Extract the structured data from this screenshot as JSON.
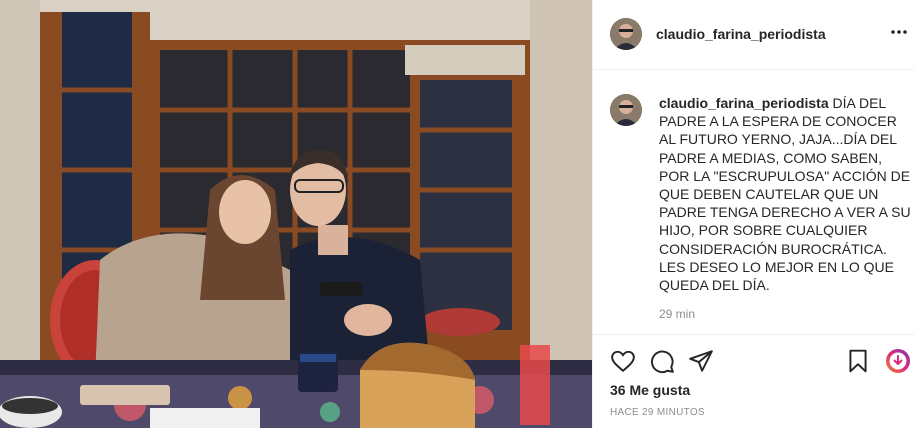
{
  "post": {
    "username": "claudio_farina_periodista",
    "more_icon": "more-horizontal-icon",
    "caption_username": "claudio_farina_periodista",
    "caption_text": "DÍA DEL PADRE A LA ESPERA DE CONOCER AL FUTURO YERNO, JAJA...DÍA DEL PADRE A MEDIAS, COMO SABEN, POR LA \"ESCRUPULOSA\" ACCIÓN DE QUE DEBEN CAUTELAR QUE UN PADRE TENGA DERECHO A VER A SU HIJO, POR SOBRE CUALQUIER CONSIDERACIÓN BUROCRÁTICA. LES DESEO LO MEJOR EN LO QUE QUEDA DEL DÍA.",
    "caption_time": "29 min",
    "likes": "36 Me gusta",
    "timestamp": "HACE 29 MINUTOS"
  },
  "icons": {
    "like": "heart-icon",
    "comment": "comment-icon",
    "share": "send-icon",
    "save": "bookmark-icon",
    "extension": "download-circle-icon"
  },
  "colors": {
    "text": "#262626",
    "muted": "#8e8e8e",
    "border": "#efefef",
    "extension_gradient": [
      "#f58529",
      "#dd2a7b",
      "#8134af"
    ]
  }
}
